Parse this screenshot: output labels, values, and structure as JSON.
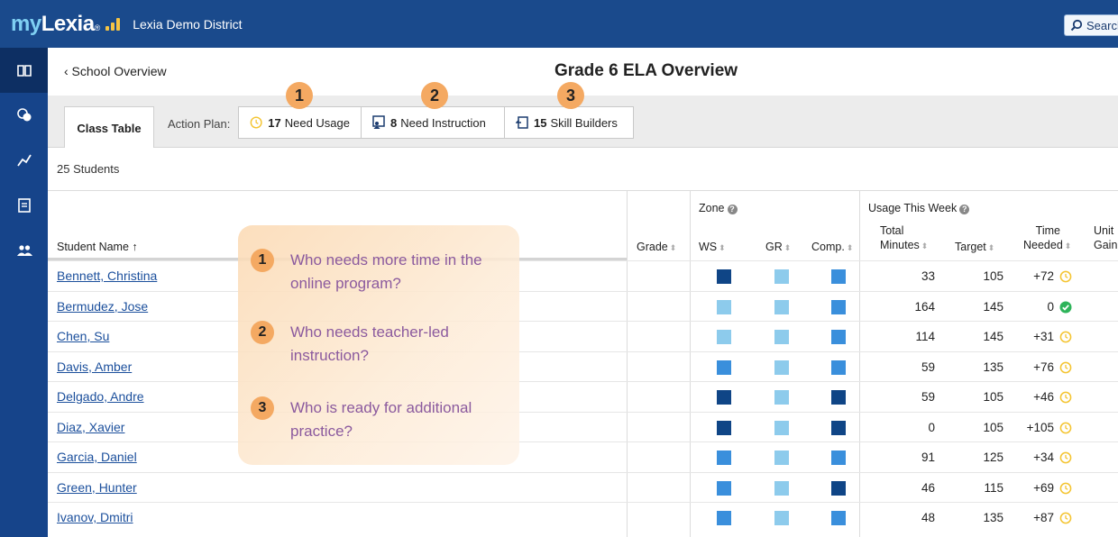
{
  "colors": {
    "topbar": "#1a4a8c",
    "nav": "#16448a",
    "zone_dark": "#0f4586",
    "zone_mid": "#3a8fdc",
    "zone_light": "#8dcbec",
    "clock": "#f4c430",
    "check": "#2eb45a",
    "callout_text": "#8b5a9e",
    "badge": "#f4a962"
  },
  "topbar": {
    "logo_my": "my",
    "logo_lexia": "Lexia",
    "logo_reg": "®",
    "district": "Lexia Demo District",
    "search_label": "Search"
  },
  "nav_icons": [
    "book-icon",
    "chat-icon",
    "trend-icon",
    "report-icon",
    "people-icon"
  ],
  "header": {
    "back_label": "‹ School Overview",
    "title": "Grade 6 ELA Overview"
  },
  "tabs": {
    "class_table": "Class Table",
    "action_plan_label": "Action Plan:",
    "need_usage_count": "17",
    "need_usage_label": "Need Usage",
    "need_instruction_count": "8",
    "need_instruction_label": "Need Instruction",
    "skill_builders_count": "15",
    "skill_builders_label": "Skill Builders"
  },
  "badges": [
    "1",
    "2",
    "3"
  ],
  "student_count": "25 Students",
  "table": {
    "col_student": "Student Name ↑",
    "col_grade": "Grade",
    "zone_group": "Zone",
    "col_ws": "WS",
    "col_gr": "GR",
    "col_comp": "Comp.",
    "usage_group": "Usage This Week",
    "col_total_1": "Total",
    "col_total_2": "Minutes",
    "col_target": "Target",
    "col_time_1": "Time",
    "col_time_2": "Needed",
    "col_unit_1": "Unit",
    "col_unit_2": "Gain",
    "rows": [
      {
        "name": "Bennett, Christina",
        "ws": "dark",
        "gr": "light",
        "comp": "mid",
        "total": "33",
        "target": "105",
        "time": "+72",
        "status": "clock"
      },
      {
        "name": "Bermudez, Jose",
        "ws": "light",
        "gr": "light",
        "comp": "mid",
        "total": "164",
        "target": "145",
        "time": "0",
        "status": "check"
      },
      {
        "name": "Chen, Su",
        "ws": "light",
        "gr": "light",
        "comp": "mid",
        "total": "114",
        "target": "145",
        "time": "+31",
        "status": "clock"
      },
      {
        "name": "Davis, Amber",
        "ws": "mid",
        "gr": "light",
        "comp": "mid",
        "total": "59",
        "target": "135",
        "time": "+76",
        "status": "clock"
      },
      {
        "name": "Delgado, Andre",
        "ws": "dark",
        "gr": "light",
        "comp": "dark",
        "total": "59",
        "target": "105",
        "time": "+46",
        "status": "clock"
      },
      {
        "name": "Diaz, Xavier",
        "ws": "dark",
        "gr": "light",
        "comp": "dark",
        "total": "0",
        "target": "105",
        "time": "+105",
        "status": "clock"
      },
      {
        "name": "Garcia, Daniel",
        "ws": "mid",
        "gr": "light",
        "comp": "mid",
        "total": "91",
        "target": "125",
        "time": "+34",
        "status": "clock"
      },
      {
        "name": "Green, Hunter",
        "ws": "mid",
        "gr": "light",
        "comp": "dark",
        "total": "46",
        "target": "115",
        "time": "+69",
        "status": "clock"
      },
      {
        "name": "Ivanov, Dmitri",
        "ws": "mid",
        "gr": "light",
        "comp": "mid",
        "total": "48",
        "target": "135",
        "time": "+87",
        "status": "clock"
      }
    ]
  },
  "callout": {
    "q1_num": "1",
    "q1_text": "Who needs more time in the online program?",
    "q2_num": "2",
    "q2_text": "Who needs teacher-led instruction?",
    "q3_num": "3",
    "q3_text": "Who is ready for additional practice?"
  }
}
